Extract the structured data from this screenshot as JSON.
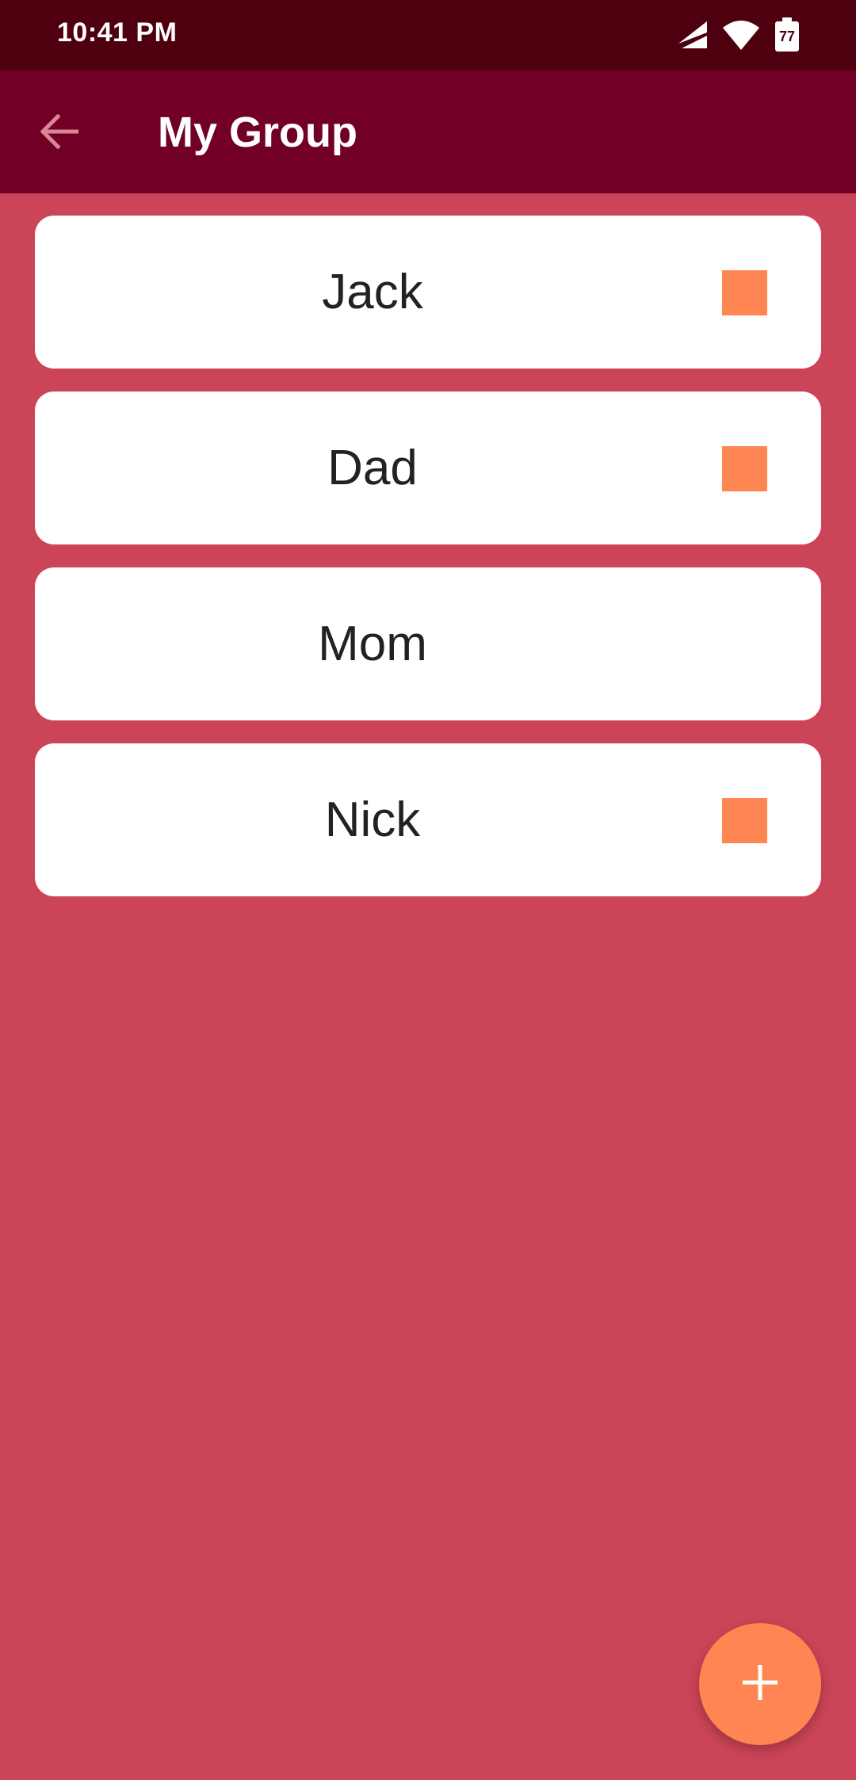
{
  "status_bar": {
    "time": "10:41 PM",
    "battery_level": "77",
    "icons": [
      "signal-icon",
      "wifi-icon",
      "battery-icon"
    ]
  },
  "app_bar": {
    "title": "My Group",
    "back_icon": "arrow-back-icon"
  },
  "members": [
    {
      "name": "Jack",
      "has_indicator": true
    },
    {
      "name": "Dad",
      "has_indicator": true
    },
    {
      "name": "Mom",
      "has_indicator": false
    },
    {
      "name": "Nick",
      "has_indicator": true
    }
  ],
  "fab": {
    "icon": "plus-icon"
  },
  "colors": {
    "status_bar": "#4f000f",
    "app_bar": "#720026",
    "background": "#cc4457",
    "accent": "#ff8552",
    "card": "#ffffff"
  }
}
